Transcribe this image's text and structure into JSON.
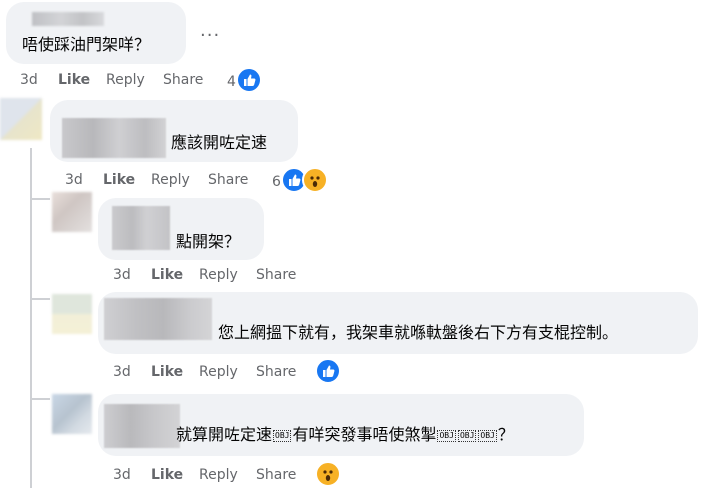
{
  "comments": [
    {
      "text": "唔使踩油門架咩？",
      "time": "3d",
      "like": "Like",
      "reply": "Reply",
      "share": "Share",
      "reaction_count": "4",
      "reactions": [
        "like"
      ]
    },
    {
      "text": "應該開咗定速",
      "time": "3d",
      "like": "Like",
      "reply": "Reply",
      "share": "Share",
      "reaction_count": "6",
      "reactions": [
        "like",
        "wow"
      ]
    },
    {
      "text": "點開架？",
      "time": "3d",
      "like": "Like",
      "reply": "Reply",
      "share": "Share",
      "reaction_count": "",
      "reactions": []
    },
    {
      "text": "您上網搵下就有，我架車就喺軚盤後右下方有支棍控制。",
      "time": "3d",
      "like": "Like",
      "reply": "Reply",
      "share": "Share",
      "reaction_count": "",
      "reactions": [
        "like"
      ]
    },
    {
      "text_part1": "就算開咗定速",
      "obj": "OBJ",
      "text_part2": "有咩突發事唔使煞掣",
      "text_end": "？",
      "time": "3d",
      "like": "Like",
      "reply": "Reply",
      "share": "Share",
      "reaction_count": "",
      "reactions": [
        "wow"
      ]
    }
  ],
  "more_options": "...",
  "colors": {
    "bubble": "#f0f2f5",
    "meta": "#65676b",
    "like_blue": "#1877f2",
    "wow_yellow": "#f7b125",
    "thread_line": "#ced0d4"
  }
}
